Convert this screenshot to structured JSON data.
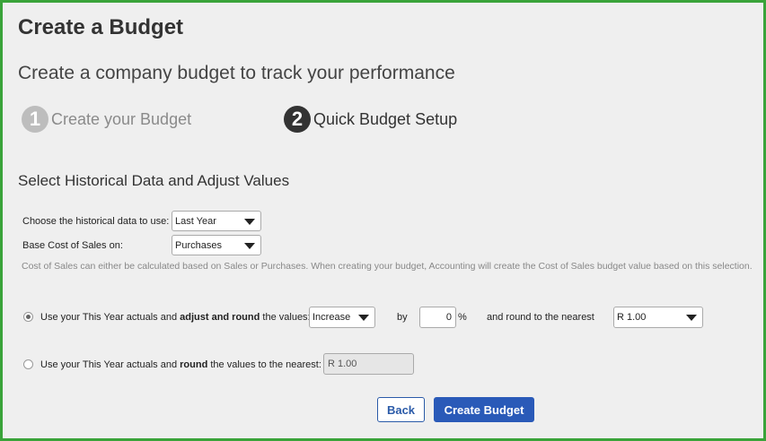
{
  "page": {
    "title": "Create a Budget",
    "subtitle": "Create a company budget to track your performance"
  },
  "steps": [
    {
      "number": "1",
      "label": "Create your Budget",
      "active": false
    },
    {
      "number": "2",
      "label": "Quick Budget Setup",
      "active": true
    }
  ],
  "section": {
    "heading": "Select Historical Data and Adjust Values"
  },
  "form": {
    "historical_label": "Choose the historical data to use:",
    "historical_value": "Last Year",
    "cost_label": "Base Cost of Sales on:",
    "cost_value": "Purchases",
    "note": "Cost of Sales can either be calculated based on Sales or Purchases. When creating your budget, Accounting will create the Cost of Sales budget value based on this selection."
  },
  "option_adjust": {
    "selected": true,
    "text_before": "Use your This Year actuals and ",
    "text_bold": "adjust and round",
    "text_after": " the values:",
    "direction_value": "Increase",
    "by_label": "by",
    "percent_value": "0",
    "percent_symbol": "%",
    "round_label": "and round to the nearest",
    "round_value": "R 1.00"
  },
  "option_round": {
    "selected": false,
    "text_before": "Use your This Year actuals and ",
    "text_bold": "round",
    "text_after": " the values to the nearest:",
    "round_value": "R 1.00"
  },
  "buttons": {
    "back": "Back",
    "create": "Create Budget"
  },
  "colors": {
    "frame_border": "#3aa33a",
    "primary": "#2a5ab8",
    "background": "#efefef"
  }
}
